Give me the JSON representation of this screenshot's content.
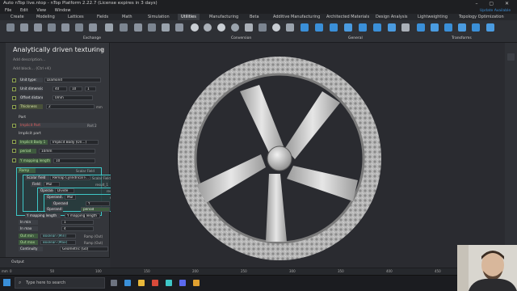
{
  "window": {
    "title": "Auto nTop live.ntop - nTop Platform 2.22.7 (License expires in 3 days)",
    "menu": [
      "File",
      "Edit",
      "View",
      "Window"
    ]
  },
  "ribbon_tabs": [
    "Create",
    "Modeling",
    "Lattices",
    "Fields",
    "Math",
    "Simulation",
    "Utilities",
    "Manufacturing",
    "Beta",
    "Additive Manufacturing",
    "Architected Materials",
    "Design Analysis",
    "Lightweighting",
    "Topology Optimization"
  ],
  "active_tab": "Utilities",
  "ribbon_groups": {
    "exchange": "Exchange",
    "conversion": "Conversion",
    "general": "General",
    "transforms": "Transforms"
  },
  "update_notice": "Update Available",
  "panel": {
    "title": "Analytically driven texturing",
    "add_description": "Add description...",
    "add_block": "Add block... (Ctrl+K)",
    "rows": {
      "unit_type": {
        "label": "Unit type:",
        "value": "Diamond"
      },
      "unit_dims": {
        "label": "Unit dimensions",
        "v1": "40",
        "v2": "10",
        "v3": "1"
      },
      "offset_distance": {
        "label": "Offset distance",
        "value": "0mm"
      },
      "thickness": {
        "label": "Thickness",
        "value": "2",
        "unit": "mm"
      },
      "part_header": "Part",
      "implicit_part": {
        "label": "Implicit Part",
        "tag": "Part 2"
      },
      "implicit_part_text": "Implicit part",
      "implicit_body": {
        "label": "Implicit Body 1",
        "value": "Implicit Body (Ori...)"
      },
      "period": {
        "label": "period",
        "value": "10mm"
      },
      "mapping_length": {
        "label": "Y mapping length",
        "value": "10"
      },
      "ramp": {
        "label": "Ramp",
        "tag": "Scalar Field"
      },
      "scalar_field": {
        "label": "Scalar field",
        "value": "Remap Cylindrical F...",
        "tag": "Scalar Field 2"
      },
      "field": {
        "label": "Field",
        "value": "Mul",
        "tag": "result_1"
      },
      "operand": {
        "label": "Operand",
        "value": "Divide",
        "tag": "result"
      },
      "operand_a": {
        "label": "Operand A",
        "value": "Mul",
        "tag": "result_1"
      },
      "operand_inner": {
        "label": "Operand",
        "value": "Y"
      },
      "operand_b": {
        "label": "Operand B",
        "value": "period",
        "unit": "mm"
      },
      "y_mapping": {
        "label": "Y mapping length",
        "value": "Y mapping length"
      },
      "in_min": {
        "label": "In min",
        "value": "1"
      },
      "in_max": {
        "label": "In max",
        "value": "4"
      },
      "out_min": {
        "label": "Out min",
        "value": "Boolean (Min)",
        "tag": "Ramp (Out)"
      },
      "out_max": {
        "label": "Out max",
        "value": "Boolean (Max)",
        "tag": "Ramp (Out)"
      },
      "continuity": {
        "label": "Continuity",
        "value": "Geometric (G0)"
      }
    }
  },
  "output_label": "Output",
  "ruler": {
    "unit": "mm",
    "ticks": [
      "0",
      "50",
      "100",
      "150",
      "200",
      "250",
      "300",
      "350",
      "400",
      "450",
      "500"
    ]
  },
  "taskbar": {
    "search_placeholder": "Type here to search"
  },
  "colors": {
    "accent_teal": "#3ec7c7",
    "accent_green": "#8ea34f",
    "update_blue": "#3a8fd8"
  }
}
